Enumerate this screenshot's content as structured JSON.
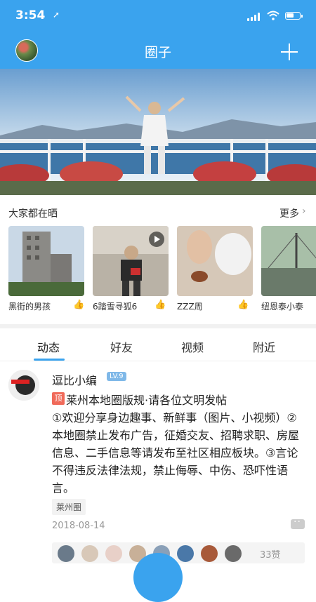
{
  "status": {
    "time": "3:54",
    "location_icon": "location-arrow-icon"
  },
  "nav": {
    "title": "圈子",
    "add_icon": "plus-icon"
  },
  "shared": {
    "title": "大家都在晒",
    "more": "更多",
    "items": [
      {
        "caption": "黑街的男孩"
      },
      {
        "caption": "6踏雪寻狐6"
      },
      {
        "caption": "ZZZ周"
      },
      {
        "caption": "纽恩泰小泰"
      }
    ]
  },
  "tabs": [
    "动态",
    "好友",
    "视频",
    "附近"
  ],
  "post": {
    "author": "逗比小编",
    "level": "LV.9",
    "pin": "顶",
    "title": "莱州本地圈版规·请各位文明发帖",
    "body": "①欢迎分享身边趣事、新鲜事（图片、小视频）②本地圈禁止发布广告，征婚交友、招聘求职、房屋信息、二手信息等请发布至社区相应板块。③言论不得违反法律法规，禁止侮辱、中伤、恐吓性语言。",
    "tag": "莱州圈",
    "date": "2018-08-14",
    "likes": "33赞"
  },
  "colors": {
    "accent": "#3aa3ee",
    "pin": "#f06a5a"
  }
}
